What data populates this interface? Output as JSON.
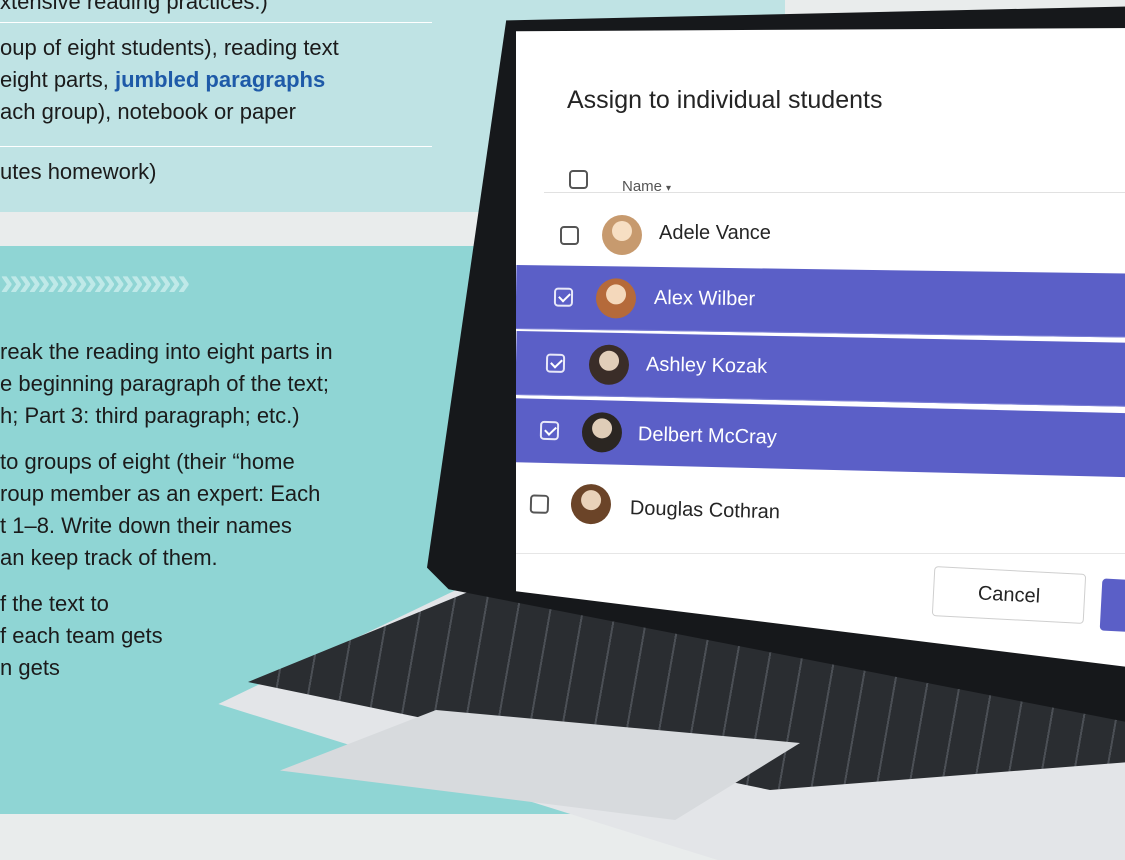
{
  "background": {
    "prep_lines": [
      "xtensive reading practices.)",
      "oup of eight students), reading text",
      "eight parts, ",
      "ach group), notebook or paper",
      "utes homework)"
    ],
    "prep_accent": "jumbled paragraphs",
    "chevrons": "››››››››››››››››››››",
    "step_lines": [
      "reak the reading into eight parts in",
      "e beginning paragraph of the text;",
      "h; Part 3: third paragraph; etc.)",
      "to groups of eight (their “home",
      "roup member as an expert: Each",
      "t 1–8. Write down their names",
      "an keep track of them.",
      "f the text to",
      "f each team gets",
      "n gets"
    ],
    "colors": {
      "top_panel": "#bfe3e4",
      "mid_panel": "#8fd5d4",
      "accent_text": "#1e5aa8"
    }
  },
  "dialog": {
    "title": "Assign to individual students",
    "column_header": "Name",
    "header_caret": "▾",
    "students": [
      {
        "name": "Adele Vance",
        "selected": false
      },
      {
        "name": "Alex Wilber",
        "selected": true
      },
      {
        "name": "Ashley Kozak",
        "selected": true
      },
      {
        "name": "Delbert McCray",
        "selected": true
      },
      {
        "name": "Douglas Cothran",
        "selected": false
      }
    ],
    "cancel_label": "Cancel",
    "accent_color": "#5b5fc7"
  }
}
